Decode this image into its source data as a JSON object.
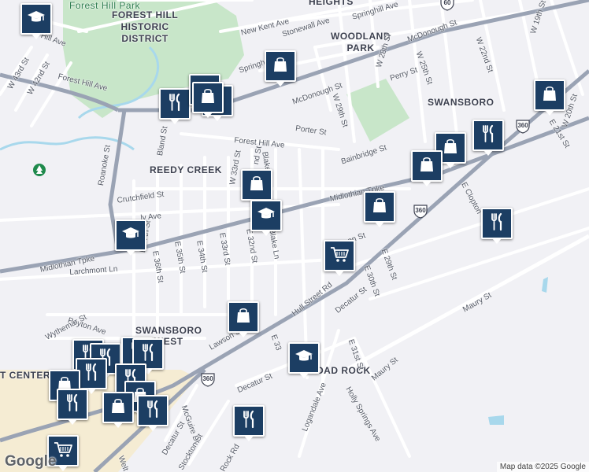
{
  "map": {
    "areas": {
      "forest_hill_park": "Forest Hill Park",
      "forest_hill_historic": [
        "FOREST HILL",
        "HISTORIC",
        "DISTRICT"
      ],
      "woodland_park": [
        "WOODLAND",
        "PARK"
      ],
      "swansboro": "SWANSBORO",
      "reedy_creek": "REEDY CREEK",
      "swansboro_west": [
        "SWANSBORO",
        "WEST"
      ],
      "heights": "HEIGHTS",
      "broad_rock": "BROAD ROCK",
      "port_center": "T CENTER"
    },
    "streets": {
      "new_kent_ave": "New Kent Ave",
      "springhill_ave": "Springhill Ave",
      "stonewall_ave": "Stonewall Ave",
      "mcdonough_st_ne": "McDonough St",
      "w_19th_st": "W 19th St",
      "w_22nd_st": "W 22nd St",
      "w_25th_st": "W 25th St",
      "w_28th_st": "W 28th St",
      "w_29th_st": "W 29th St",
      "perry_st": "Perry St",
      "mcdonough_st": "McDonough St",
      "springh_trunc": "Springh",
      "hill_ave": "Hill Ave",
      "w_43rd_st": "W 43rd St",
      "w_42nd_st": "W 42nd St",
      "forest_hill_ave_w": "Forest Hill Ave",
      "porter_st": "Porter St",
      "forest_hill_ave": "Forest Hill Ave",
      "bainbridge_st": "Bainbridge St",
      "w_20th_st": "W 20th St",
      "e_21st_st": "E 21st St",
      "w_2_trunc": "W 2",
      "e_clopton": "E Clopton",
      "bland_st": "Bland St",
      "roanoke_st": "Roanoke St",
      "w_33rd_st": "W 33rd St",
      "nd_st": "nd St",
      "blake_ln_n": "Blake Ln",
      "crutchfield_st": "Crutchfield St",
      "midlothian_tpke_e": "Midlothian Tpke",
      "ly_ave": "ly Ave",
      "midlothian_tpke_w": "Midlothian Tpke",
      "e_37th_st": "E 37th St",
      "e_36th_st": "E 36th St",
      "e_35th_st": "E 35th St",
      "e_34th_st": "E 34th St",
      "e_33rd_st": "E 33rd St",
      "e_32nd_st": "E 32nd St",
      "blake_ln": "Blake Ln",
      "on_st": "on St",
      "larchmont_ln": "Larchmont Ln",
      "e_29th_st": "E 29th St",
      "e_30th_st": "E 30th St",
      "hull_street_rd": "Hull Street Rd",
      "decatur_st_n": "Decatur St",
      "maury_st_n": "Maury St",
      "peyton_ave": "Peyton Ave",
      "wythemar_st": "Wythemar St",
      "lawson_st": "Lawson St",
      "e_33_trunc": "E 33",
      "e_31st_st": "E 31st St",
      "maury_st": "Maury St",
      "holly_springs_ave": "Holly Springs Ave",
      "decatur_st": "Decatur St",
      "logandale_ave": "Logandale Ave",
      "mcguire_dr": "McGuire Dr",
      "decatur_st_sw": "Decatur St",
      "stockton_st": "Stockton St",
      "rock_rd": "Rock Rd",
      "welt_trunc": "Welt"
    },
    "shields": [
      "60",
      "360",
      "360",
      "360"
    ],
    "pins": [
      {
        "type": "school"
      },
      {
        "type": "shopping"
      },
      {
        "type": "shopping"
      },
      {
        "type": "restaurant"
      },
      {
        "type": "school"
      },
      {
        "type": "shopping"
      },
      {
        "type": "shopping"
      },
      {
        "type": "shopping"
      },
      {
        "type": "restaurant"
      },
      {
        "type": "shopping"
      },
      {
        "type": "shopping"
      },
      {
        "type": "school"
      },
      {
        "type": "shopping"
      },
      {
        "type": "school"
      },
      {
        "type": "restaurant"
      },
      {
        "type": "grocery"
      },
      {
        "type": "shopping"
      },
      {
        "type": "school"
      },
      {
        "type": "restaurant"
      },
      {
        "type": "restaurant"
      },
      {
        "type": "restaurant"
      },
      {
        "type": "restaurant"
      },
      {
        "type": "restaurant"
      },
      {
        "type": "shopping"
      },
      {
        "type": "restaurant"
      },
      {
        "type": "shopping"
      },
      {
        "type": "restaurant"
      },
      {
        "type": "shopping"
      },
      {
        "type": "restaurant"
      },
      {
        "type": "restaurant"
      },
      {
        "type": "grocery"
      }
    ],
    "icons": {
      "school": "graduation-cap-icon",
      "shopping": "shopping-bag-icon",
      "restaurant": "fork-knife-icon",
      "grocery": "shopping-cart-icon",
      "park": "tree-icon"
    },
    "colors": {
      "background": "#f1f1f5",
      "park": "#c8e6c9",
      "water": "#a8d8ec",
      "road": "#ffffff",
      "highway": "#9aa3b4",
      "pin": "#1c3e63",
      "pin_border": "#ffffff",
      "industrial": "#f5ecd3"
    }
  },
  "branding": {
    "logo": "Google",
    "attribution": "Map data ©2025 Google"
  }
}
